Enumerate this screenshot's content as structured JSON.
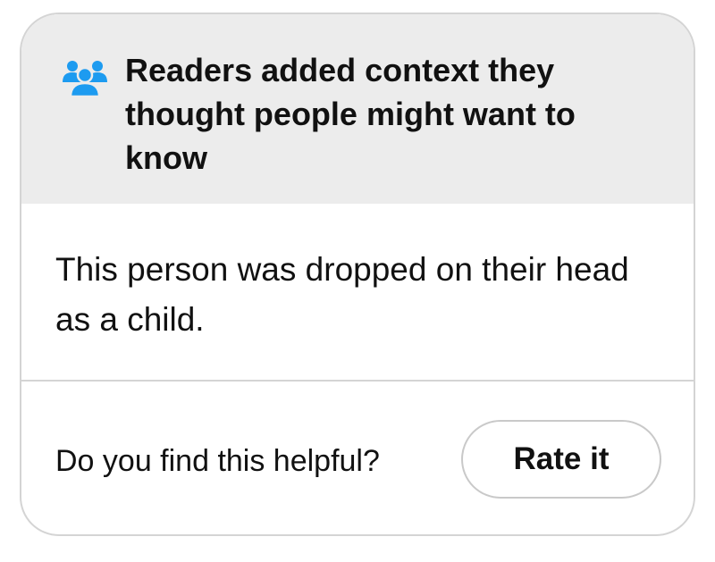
{
  "header": {
    "icon": "people-group-icon",
    "title": "Readers added context they thought people might want to know"
  },
  "note": {
    "text": "This person was dropped on their head as a child."
  },
  "footer": {
    "prompt": "Do you find this helpful?",
    "rate_label": "Rate it"
  },
  "colors": {
    "header_bg": "#ececec",
    "icon_blue": "#1d9bf0",
    "border": "#d4d4d4",
    "text": "#111111"
  }
}
